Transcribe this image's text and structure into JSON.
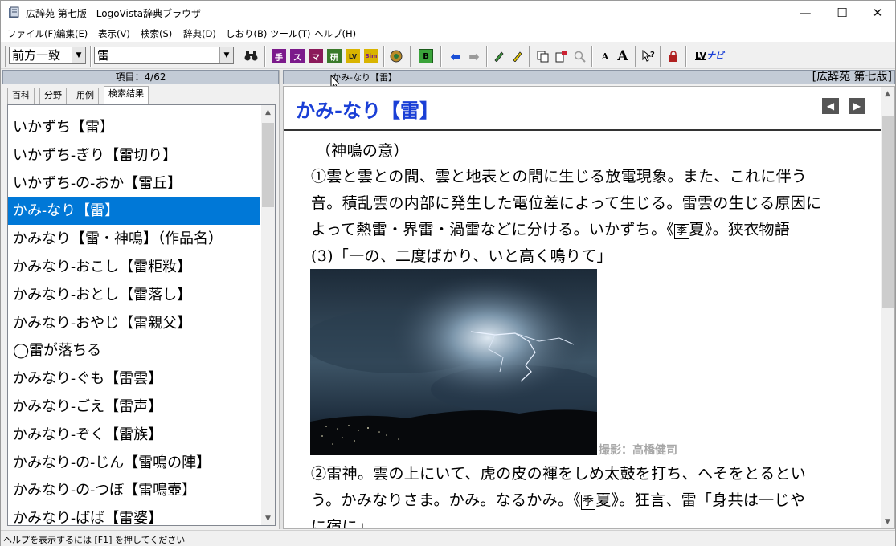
{
  "window": {
    "title": "広辞苑 第七版 - LogoVista辞典ブラウザ",
    "minimize_glyph": "—",
    "maximize_glyph": "☐",
    "close_glyph": "✕"
  },
  "menu": {
    "items": [
      "ファイル(F)",
      "編集(E)",
      "表示(V)",
      "検索(S)",
      "辞典(D)",
      "しおり(B)",
      "ツール(T)",
      "ヘルプ(H)"
    ]
  },
  "toolbar": {
    "search_mode": "前方一致",
    "search_query": "雷",
    "binoculars_icon": "binoculars-icon",
    "dict_buttons": [
      "手",
      "ス",
      "マ",
      "研",
      "LV",
      "Sim"
    ],
    "b_button": "B",
    "font_small": "A",
    "font_large": "A",
    "navi_label": "ナビ",
    "navi_prefix": "LV"
  },
  "left_pane": {
    "header": "項目：4/62",
    "tabs": [
      "百科",
      "分野",
      "用例",
      "検索結果"
    ],
    "active_tab": 3,
    "items": [
      "いかずち【雷】",
      "いかずち‐ぎり【雷切り】",
      "いかずち‐の‐おか【雷丘】",
      "かみ‐なり【雷】",
      "かみなり【雷・神鳴】（作品名）",
      "かみなり‐おこし【雷粔籹】",
      "かみなり‐おとし【雷落し】",
      "かみなり‐おやじ【雷親父】",
      "◯雷が落ちる",
      "かみなり‐ぐも【雷雲】",
      "かみなり‐ごえ【雷声】",
      "かみなり‐ぞく【雷族】",
      "かみなり‐の‐じん【雷鳴の陣】",
      "かみなり‐の‐つぼ【雷鳴壺】",
      "かみなり‐ばば【雷婆】"
    ],
    "selected_index": 3
  },
  "right_pane": {
    "header_entry": "かみ-なり【雷】",
    "header_dict": "[広辞苑 第七版]",
    "entry_title": "かみ‐なり【雷】",
    "prev_glyph": "◀",
    "next_glyph": "▶",
    "line1": "（神鳴の意）",
    "line2": "①雲と雲との間、雲と地表との間に生じる放電現象。また、これに伴う",
    "line3": "音。積乱雲の内部に発生した電位差によって生じる。雷雲の生じる原因に",
    "line4_a": "よって熱雷・界雷・渦雷などに分ける。いかずち。《",
    "line4_seal": "季",
    "line4_b": "夏》。狭衣物語",
    "line5": "(3)「一の、二度ばかり、いと高く鳴りて」",
    "photo_credit": "撮影：高橋健司",
    "line6": "②雷神。雲の上にいて、虎の皮の褌をしめ太鼓を打ち、へそをとるとい",
    "line7_a": "う。かみなりさま。かみ。なるかみ。《",
    "line7_seal": "季",
    "line7_b": "夏》。狂言、雷「身共は一じや",
    "line8": "に宿に」"
  },
  "status": {
    "text": "ヘルプを表示するには [F1] を押してください"
  }
}
